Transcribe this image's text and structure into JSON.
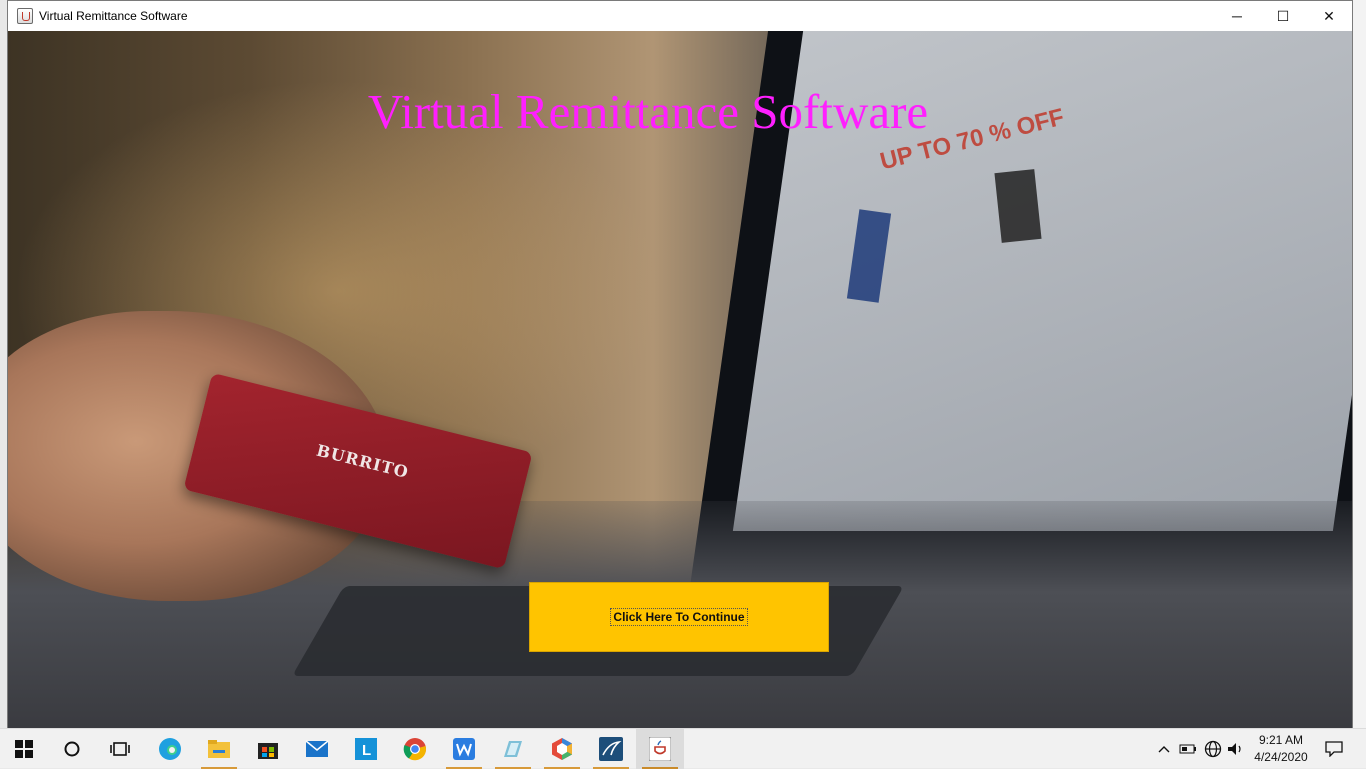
{
  "window": {
    "title": "Virtual Remittance Software",
    "controls": {
      "minimize": "─",
      "maximize": "☐",
      "close": "✕"
    }
  },
  "main": {
    "heading": "Virtual Remittance Software",
    "continue_button": "Click Here To Continue",
    "background_photo_text": {
      "card_brand": "BURRITO",
      "screen_promo": "UP TO 70 % OFF"
    }
  },
  "colors": {
    "heading": "#ff1fff",
    "button": "#ffc400"
  },
  "taskbar": {
    "icons": [
      "windows-start-icon",
      "search-icon",
      "task-view-icon",
      "edge-icon",
      "file-explorer-icon",
      "store-icon",
      "mail-icon",
      "l-app-icon",
      "chrome-icon",
      "wps-icon",
      "notes-icon",
      "hexagon-app-icon",
      "database-app-icon",
      "java-app-icon"
    ],
    "clock_time": "9:21 AM",
    "clock_date": "4/24/2020"
  }
}
